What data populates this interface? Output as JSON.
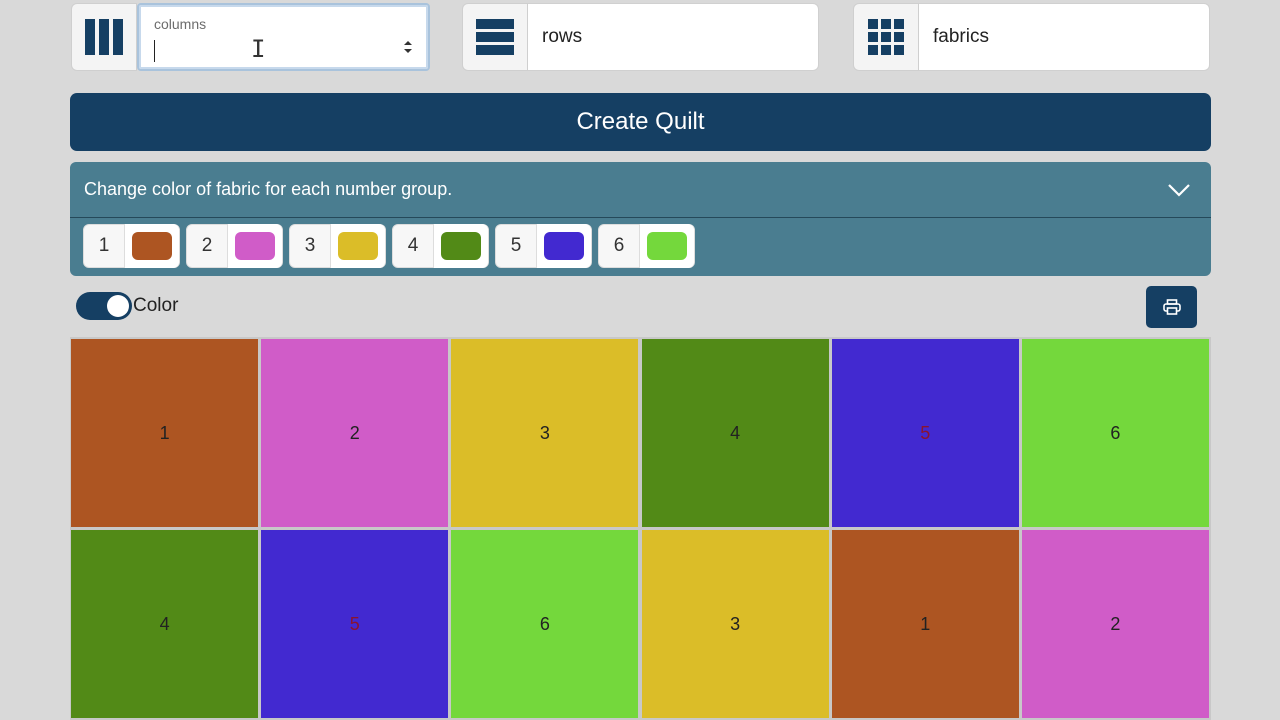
{
  "inputs": {
    "columns": {
      "label": "columns",
      "value": ""
    },
    "rows": {
      "placeholder": "rows"
    },
    "fabrics": {
      "placeholder": "fabrics"
    }
  },
  "create_button": "Create Quilt",
  "color_panel": {
    "header": "Change color of fabric for each number group.",
    "groups": [
      {
        "number": "1",
        "color": "#ad5522"
      },
      {
        "number": "2",
        "color": "#d05cc8"
      },
      {
        "number": "3",
        "color": "#dbbd28"
      },
      {
        "number": "4",
        "color": "#528a17"
      },
      {
        "number": "5",
        "color": "#4229d0"
      },
      {
        "number": "6",
        "color": "#74d83c"
      }
    ]
  },
  "toggle": {
    "label": "Color",
    "on": true
  },
  "print_icon": "printer-icon",
  "quilt": {
    "columns": 6,
    "rows": [
      [
        "1",
        "2",
        "3",
        "4",
        "5",
        "6"
      ],
      [
        "4",
        "5",
        "6",
        "3",
        "1",
        "2"
      ]
    ],
    "text_colors": {
      "5": "#8a1430"
    }
  }
}
